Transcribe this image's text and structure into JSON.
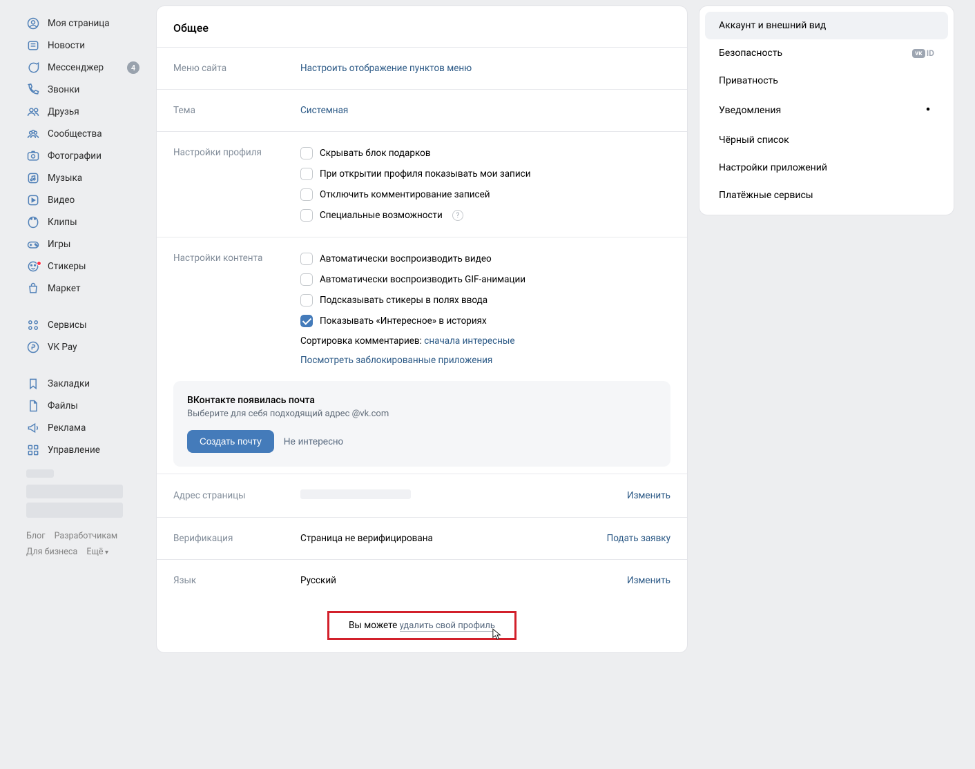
{
  "nav": {
    "items": [
      {
        "icon": "user-circle",
        "label": "Моя страница"
      },
      {
        "icon": "newspaper",
        "label": "Новости"
      },
      {
        "icon": "chat",
        "label": "Мессенджер",
        "badge": "4"
      },
      {
        "icon": "phone",
        "label": "Звонки"
      },
      {
        "icon": "users",
        "label": "Друзья"
      },
      {
        "icon": "group",
        "label": "Сообщества"
      },
      {
        "icon": "photo",
        "label": "Фотографии"
      },
      {
        "icon": "music",
        "label": "Музыка"
      },
      {
        "icon": "video",
        "label": "Видео"
      },
      {
        "icon": "clips",
        "label": "Клипы"
      },
      {
        "icon": "game",
        "label": "Игры"
      },
      {
        "icon": "sticker",
        "label": "Стикеры",
        "dot": true
      },
      {
        "icon": "market",
        "label": "Маркет"
      }
    ],
    "items2": [
      {
        "icon": "services",
        "label": "Сервисы"
      },
      {
        "icon": "pay",
        "label": "VK Pay"
      }
    ],
    "items3": [
      {
        "icon": "bookmark",
        "label": "Закладки"
      },
      {
        "icon": "file",
        "label": "Файлы"
      },
      {
        "icon": "ads",
        "label": "Реклама"
      },
      {
        "icon": "manage",
        "label": "Управление"
      }
    ],
    "footer": {
      "blog": "Блог",
      "dev": "Разработчикам",
      "biz": "Для бизнеса",
      "more": "Ещё"
    }
  },
  "main": {
    "title": "Общее",
    "site_menu": {
      "label": "Меню сайта",
      "link": "Настроить отображение пунктов меню"
    },
    "theme": {
      "label": "Тема",
      "value": "Системная"
    },
    "profile": {
      "label": "Настройки профиля",
      "opts": [
        {
          "text": "Скрывать блок подарков",
          "checked": false
        },
        {
          "text": "При открытии профиля показывать мои записи",
          "checked": false
        },
        {
          "text": "Отключить комментирование записей",
          "checked": false
        },
        {
          "text": "Специальные возможности",
          "checked": false,
          "help": true
        }
      ]
    },
    "content": {
      "label": "Настройки контента",
      "opts": [
        {
          "text": "Автоматически воспроизводить видео",
          "checked": false
        },
        {
          "text": "Автоматически воспроизводить GIF-анимации",
          "checked": false
        },
        {
          "text": "Подсказывать стикеры в полях ввода",
          "checked": false
        },
        {
          "text": "Показывать «Интересное» в историях",
          "checked": true
        }
      ],
      "sort_label": "Сортировка комментариев: ",
      "sort_value": "сначала интересные",
      "blocked_apps": "Посмотреть заблокированные приложения"
    },
    "mail": {
      "title": "ВКонтакте появилась почта",
      "desc": "Выберите для себя подходящий адрес @vk.com",
      "create": "Создать почту",
      "dismiss": "Не интересно"
    },
    "address": {
      "label": "Адрес страницы",
      "action": "Изменить"
    },
    "verify": {
      "label": "Верификация",
      "value": "Страница не верифицирована",
      "action": "Подать заявку"
    },
    "lang": {
      "label": "Язык",
      "value": "Русский",
      "action": "Изменить"
    },
    "delete": {
      "prefix": "Вы можете ",
      "link": "удалить свой профиль"
    }
  },
  "tabs": [
    {
      "label": "Аккаунт и внешний вид",
      "active": true
    },
    {
      "label": "Безопасность",
      "vkid": true
    },
    {
      "label": "Приватность"
    },
    {
      "label": "Уведомления",
      "gear": true
    },
    {
      "label": "Чёрный список"
    },
    {
      "label": "Настройки приложений"
    },
    {
      "label": "Платёжные сервисы"
    }
  ]
}
